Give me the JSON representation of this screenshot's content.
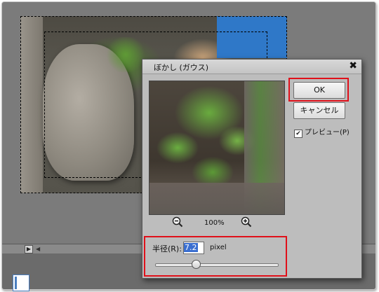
{
  "dialog": {
    "title": "ぼかし (ガウス)",
    "close_label": "✖",
    "ok_label": "OK",
    "cancel_label": "キャンセル",
    "preview_checkbox": {
      "label": "プレビュー(P)",
      "checked": true
    },
    "zoom_level": "100%",
    "radius": {
      "label": "半径(R):",
      "value": "7.2",
      "unit": "pixel",
      "slider_fraction": 0.33
    }
  },
  "icons": {
    "zoom_out": "zoom-out-icon",
    "zoom_in": "zoom-in-icon",
    "scroll_right": "play-icon",
    "scroll_left": "left-arrow-icon"
  },
  "colors": {
    "highlight_box": "#e0101a",
    "selection_text_bg": "#3b6fd0"
  }
}
